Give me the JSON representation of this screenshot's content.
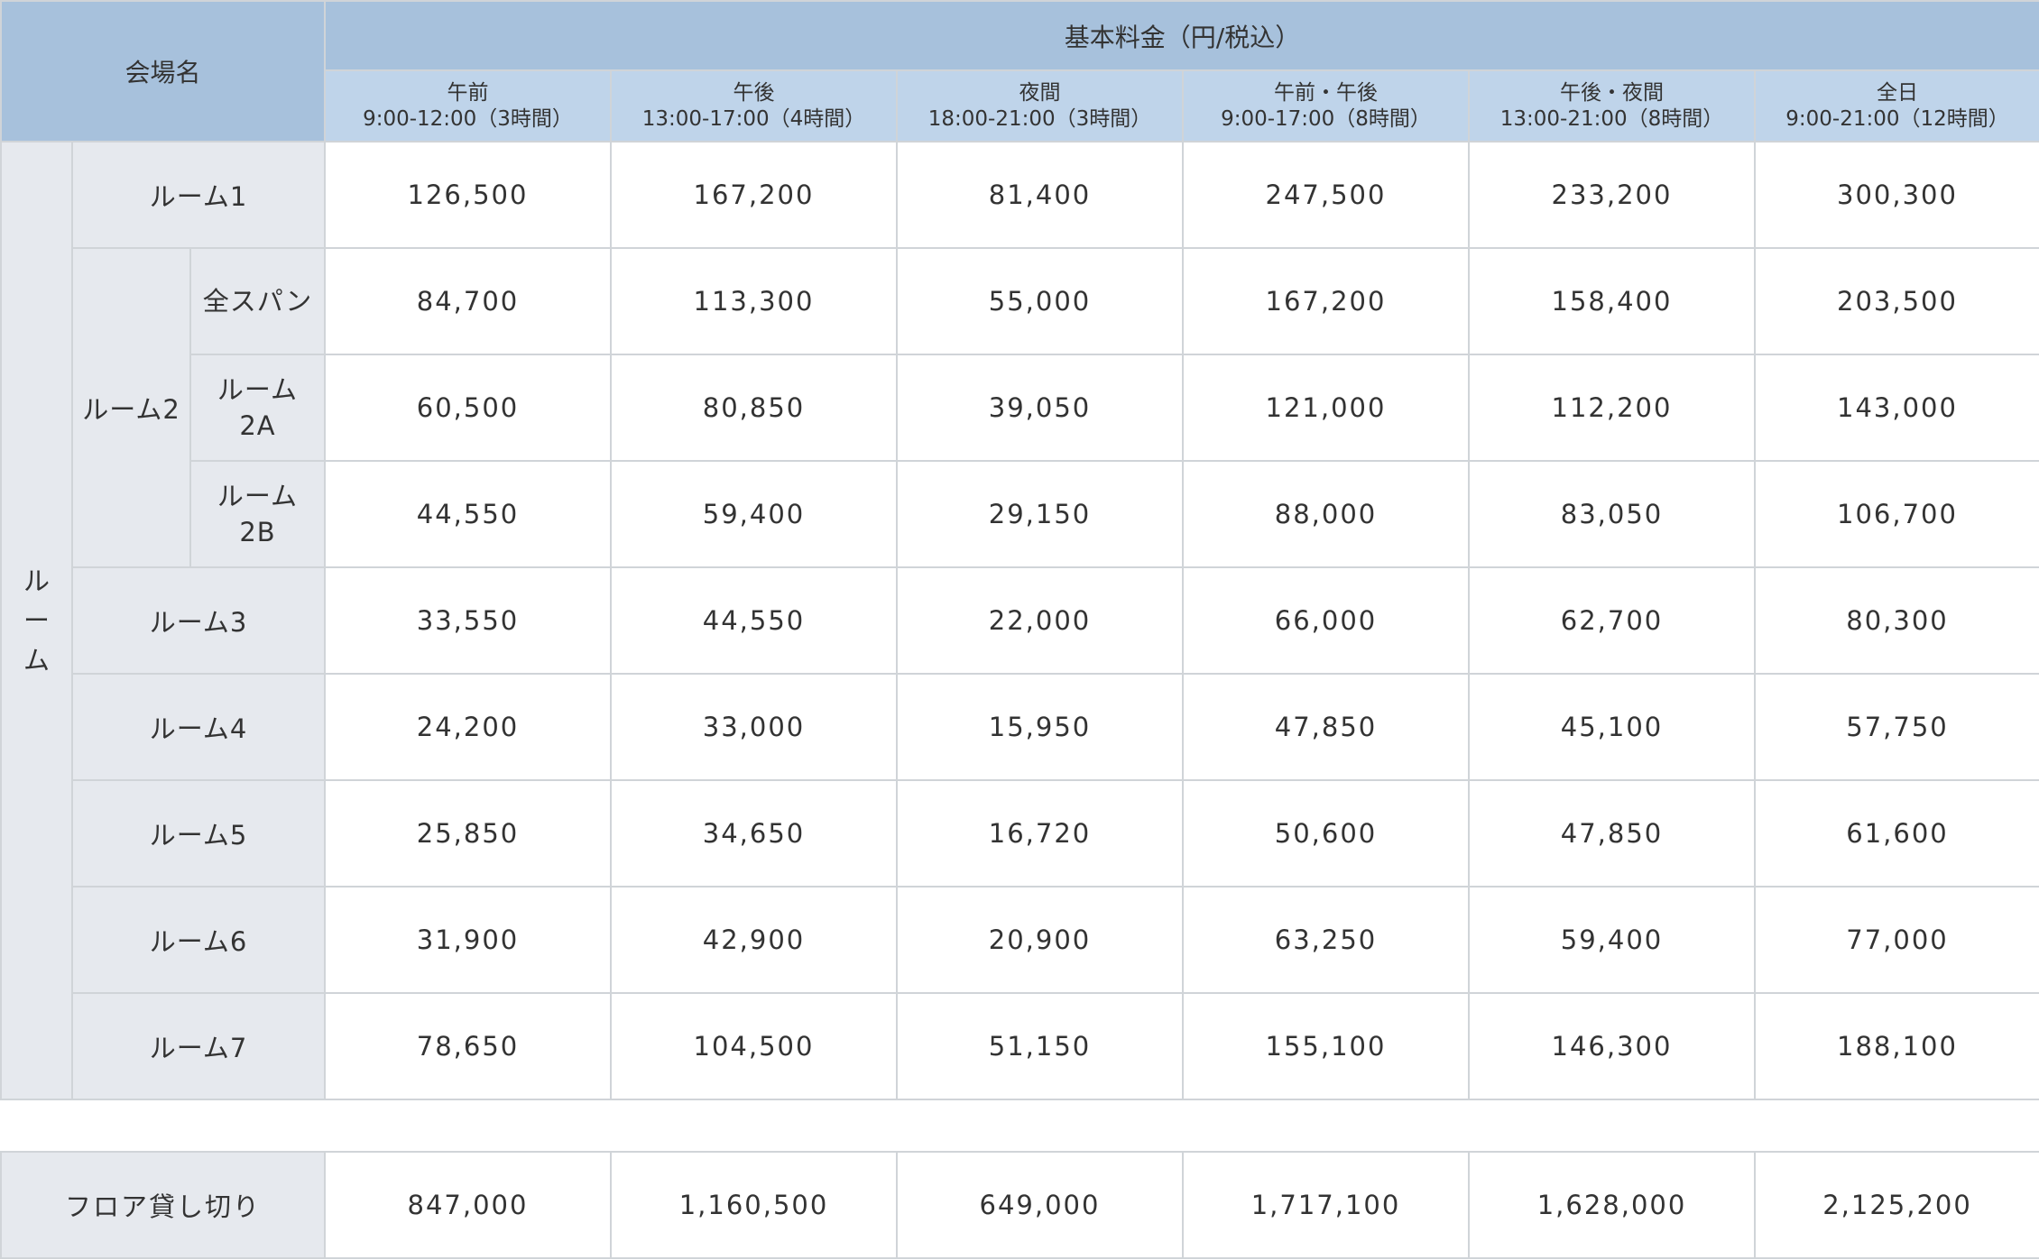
{
  "header": {
    "venue_label": "会場名",
    "base_fee_label": "基本料金（円/税込）",
    "slots": [
      {
        "name": "午前",
        "time": "9:00-12:00（3時間）"
      },
      {
        "name": "午後",
        "time": "13:00-17:00（4時間）"
      },
      {
        "name": "夜間",
        "time": "18:00-21:00（3時間）"
      },
      {
        "name": "午前・午後",
        "time": "9:00-17:00（8時間）"
      },
      {
        "name": "午後・夜間",
        "time": "13:00-21:00（8時間）"
      },
      {
        "name": "全日",
        "time": "9:00-21:00（12時間）"
      }
    ]
  },
  "category": {
    "chars": [
      "ル",
      "ー",
      "ム"
    ]
  },
  "rooms": [
    {
      "label": "ルーム1",
      "prices": [
        "126,500",
        "167,200",
        "81,400",
        "247,500",
        "233,200",
        "300,300"
      ]
    },
    {
      "label": "ルーム2",
      "subs": [
        {
          "label": "全スパン",
          "prices": [
            "84,700",
            "113,300",
            "55,000",
            "167,200",
            "158,400",
            "203,500"
          ]
        },
        {
          "label_line1": "ルーム",
          "label_line2": "2A",
          "prices": [
            "60,500",
            "80,850",
            "39,050",
            "121,000",
            "112,200",
            "143,000"
          ]
        },
        {
          "label_line1": "ルーム",
          "label_line2": "2B",
          "prices": [
            "44,550",
            "59,400",
            "29,150",
            "88,000",
            "83,050",
            "106,700"
          ]
        }
      ]
    },
    {
      "label": "ルーム3",
      "prices": [
        "33,550",
        "44,550",
        "22,000",
        "66,000",
        "62,700",
        "80,300"
      ]
    },
    {
      "label": "ルーム4",
      "prices": [
        "24,200",
        "33,000",
        "15,950",
        "47,850",
        "45,100",
        "57,750"
      ]
    },
    {
      "label": "ルーム5",
      "prices": [
        "25,850",
        "34,650",
        "16,720",
        "50,600",
        "47,850",
        "61,600"
      ]
    },
    {
      "label": "ルーム6",
      "prices": [
        "31,900",
        "42,900",
        "20,900",
        "63,250",
        "59,400",
        "77,000"
      ]
    },
    {
      "label": "ルーム7",
      "prices": [
        "78,650",
        "104,500",
        "51,150",
        "155,100",
        "146,300",
        "188,100"
      ]
    }
  ],
  "floor": {
    "label": "フロア貸し切り",
    "prices": [
      "847,000",
      "1,160,500",
      "649,000",
      "1,717,100",
      "1,628,000",
      "2,125,200"
    ]
  },
  "colors": {
    "header_dark": "#a7c1dc",
    "header_light": "#bfd4ea",
    "label_bg": "#e6e9ee",
    "border": "#d0d4d8"
  }
}
